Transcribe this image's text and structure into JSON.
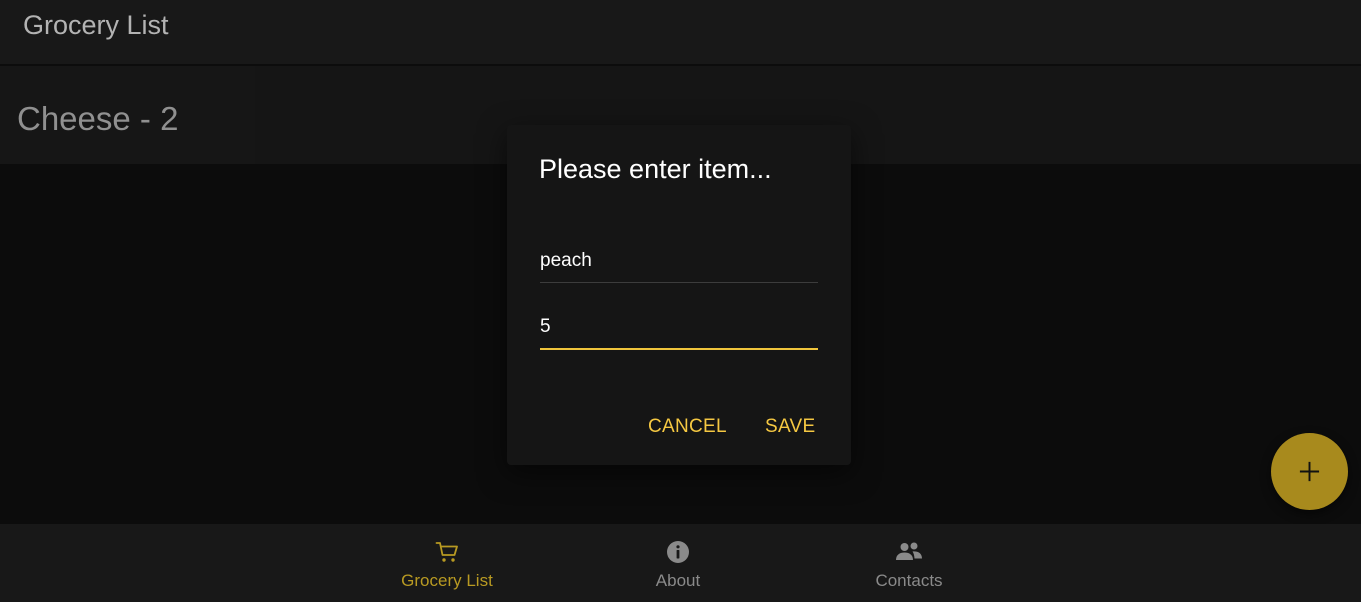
{
  "app": {
    "title": "Grocery List"
  },
  "list": {
    "items": [
      {
        "label": "Cheese - 2"
      }
    ]
  },
  "dialog": {
    "title": "Please enter item...",
    "fields": {
      "name_value": "peach",
      "quantity_value": "5"
    },
    "buttons": {
      "cancel_label": "CANCEL",
      "save_label": "SAVE"
    }
  },
  "fab": {
    "icon": "plus-icon"
  },
  "bottom_nav": {
    "items": [
      {
        "label": "Grocery List",
        "icon": "cart-icon",
        "active": true
      },
      {
        "label": "About",
        "icon": "info-icon",
        "active": false
      },
      {
        "label": "Contacts",
        "icon": "people-icon",
        "active": false
      }
    ]
  },
  "colors": {
    "accent": "#f5c842",
    "fab": "#a88a1d",
    "nav_active": "#b89a22",
    "nav_inactive": "#8a8a8a",
    "surface": "#181818",
    "background": "#0c0c0c"
  }
}
